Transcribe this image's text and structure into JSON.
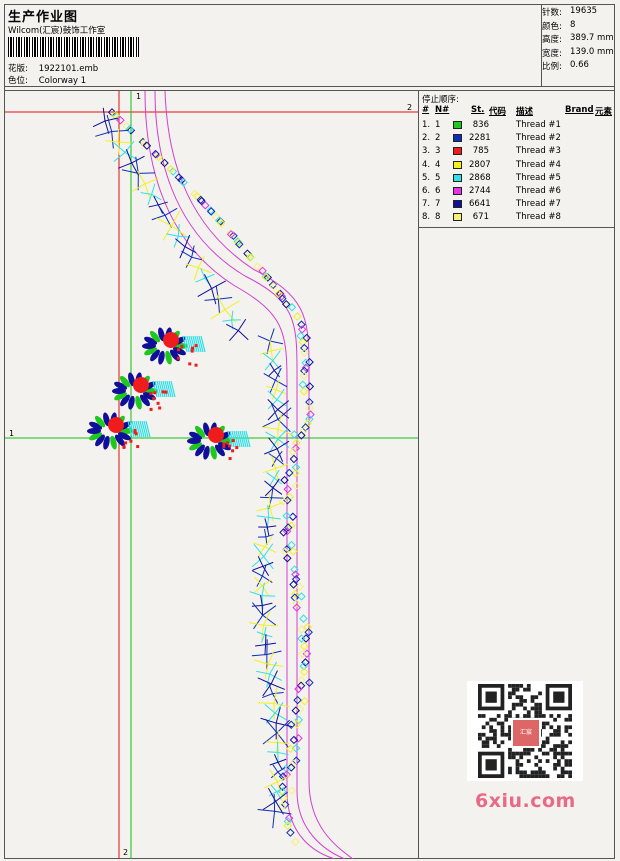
{
  "header": {
    "title": "生产作业图",
    "studio": "Wilcom(汇宸)鼓饰工作室",
    "design_label": "花版:",
    "design_file": "1922101.emb",
    "colorway_label": "色位:",
    "colorway": "Colorway 1"
  },
  "stats": [
    {
      "label": "针数:",
      "value": "19635"
    },
    {
      "label": "颜色:",
      "value": "8"
    },
    {
      "label": "高度:",
      "value": "389.7 mm"
    },
    {
      "label": "宽度:",
      "value": "139.0 mm"
    },
    {
      "label": "比例:",
      "value": "0.66"
    }
  ],
  "stop_panel": {
    "title": "停止顺序:",
    "columns": {
      "num": "#",
      "n": "N#",
      "st": "St.",
      "code": "代码",
      "desc": "描述",
      "brand": "Brand",
      "element": "元素"
    },
    "rows": [
      {
        "num": "1.",
        "n": "1",
        "color": "#1ec81e",
        "st": "836",
        "desc": "Thread #1"
      },
      {
        "num": "2.",
        "n": "2",
        "color": "#0b2fb8",
        "st": "2281",
        "desc": "Thread #2"
      },
      {
        "num": "3.",
        "n": "3",
        "color": "#ee1c1c",
        "st": "785",
        "desc": "Thread #3"
      },
      {
        "num": "4.",
        "n": "4",
        "color": "#f4f01a",
        "st": "2807",
        "desc": "Thread #4"
      },
      {
        "num": "5.",
        "n": "5",
        "color": "#2ee0e8",
        "st": "2868",
        "desc": "Thread #5"
      },
      {
        "num": "6.",
        "n": "6",
        "color": "#e634e6",
        "st": "2744",
        "desc": "Thread #6"
      },
      {
        "num": "7.",
        "n": "7",
        "color": "#0f0f9a",
        "st": "6641",
        "desc": "Thread #7"
      },
      {
        "num": "8.",
        "n": "8",
        "color": "#f6f07a",
        "st": "671",
        "desc": "Thread #8"
      }
    ]
  },
  "markers": {
    "h1": "1",
    "h2": "2",
    "v1": "1",
    "v2": "2"
  },
  "watermark": {
    "text": "6xiu.com",
    "logo_text": "汇宸"
  },
  "colors": {
    "guide_red": "#e01010",
    "guide_green": "#10c010",
    "outline": "#d040d0"
  }
}
